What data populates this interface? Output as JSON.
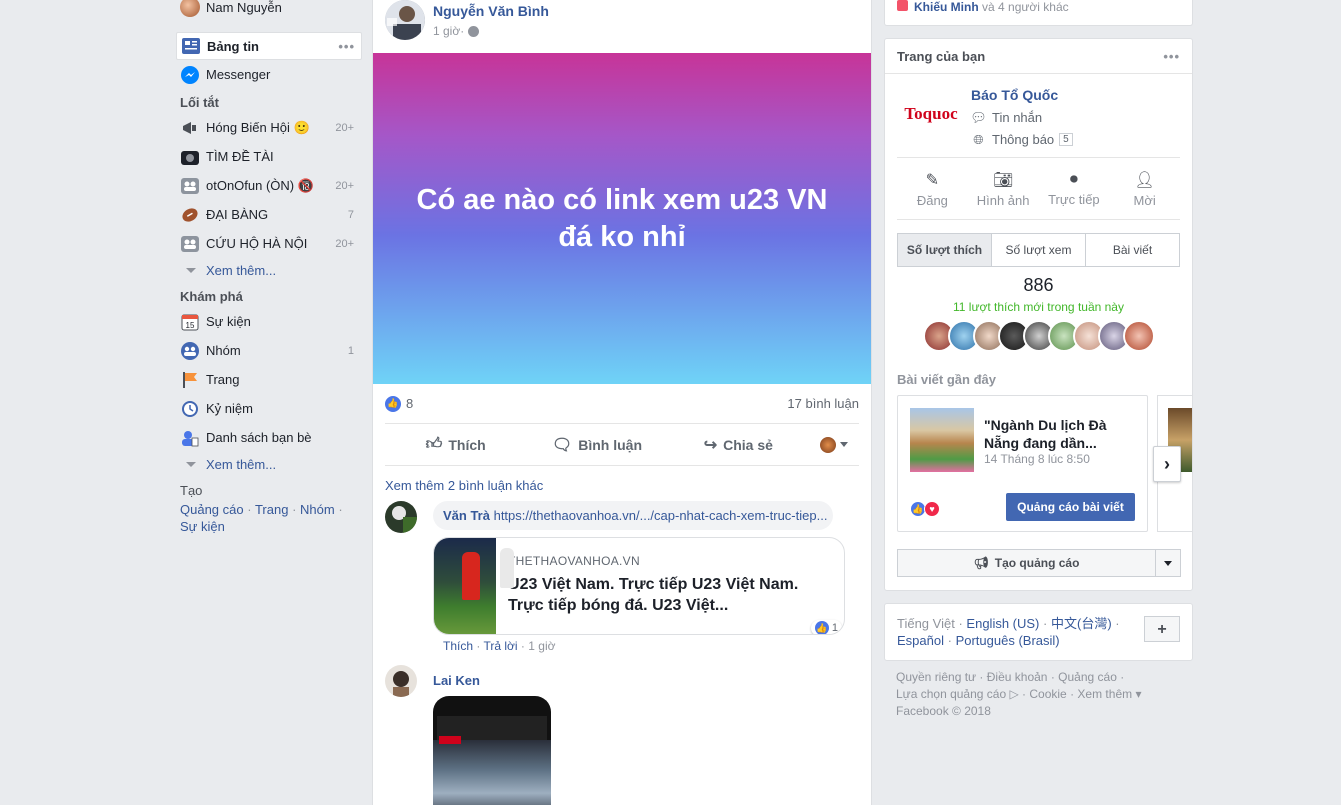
{
  "left": {
    "profile_name": "Nam Nguyễn",
    "news_feed": "Bảng tin",
    "messenger": "Messenger",
    "shortcuts_title": "Lối tắt",
    "shortcuts": [
      {
        "label": "Hóng Biến Hội 🙂",
        "count": "20+"
      },
      {
        "label": "TÌM ĐỀ TÀI",
        "count": ""
      },
      {
        "label": "otOnOfun (ÒN) 🔞",
        "count": "20+"
      },
      {
        "label": "ĐẠI BÀNG",
        "count": "7"
      },
      {
        "label": "CỨU HỘ HÀ NỘI",
        "count": "20+"
      }
    ],
    "see_more": "Xem thêm...",
    "explore_title": "Khám phá",
    "explore": [
      {
        "label": "Sự kiện",
        "count": ""
      },
      {
        "label": "Nhóm",
        "count": "1"
      },
      {
        "label": "Trang",
        "count": ""
      },
      {
        "label": "Kỷ niệm",
        "count": ""
      },
      {
        "label": "Danh sách bạn bè",
        "count": ""
      }
    ],
    "create_title": "Tạo",
    "create_links": [
      "Quảng cáo",
      "Trang",
      "Nhóm",
      "Sự kiện"
    ]
  },
  "post": {
    "author": "Nguyễn Văn Bình",
    "time": "1 giờ",
    "text": "Có ae nào có link xem u23 VN đá ko nhỉ",
    "likes": "8",
    "comments_count": "17 bình luận",
    "like_label": "Thích",
    "comment_label": "Bình luận",
    "share_label": "Chia sẻ",
    "more_comments": "Xem thêm 2 bình luận khác",
    "comment1": {
      "name": "Văn Trà",
      "link": "https://thethaovanhoa.vn/.../cap-nhat-cach-xem-truc-tiep...",
      "card_domain": "THETHAOVANHOA.VN",
      "card_title": "U23 Việt Nam. Trực tiếp U23 Việt Nam. Trực tiếp bóng đá. U23 Việt...",
      "reactions": "1",
      "like": "Thích",
      "reply": "Trả lời",
      "time": "1 giờ"
    },
    "comment2": {
      "name": "Lai Ken"
    }
  },
  "right": {
    "top_text_name": "Khiếu Minh",
    "top_text_rest": "và 4 người khác",
    "your_pages": "Trang của bạn",
    "page_name": "Báo Tổ Quốc",
    "logo_text": "Toquoc",
    "messages": "Tin nhắn",
    "notifications": "Thông báo",
    "notif_count": "5",
    "actions": [
      "Đăng",
      "Hình ảnh",
      "Trực tiếp",
      "Mời"
    ],
    "tabs": [
      "Số lượt thích",
      "Số lượt xem",
      "Bài viết"
    ],
    "likes_total": "886",
    "new_likes": "11 lượt thích mới trong tuần này",
    "recent_title": "Bài viết gần đây",
    "recent_post_title": "\"Ngành Du lịch Đà Nẵng đang dần...",
    "recent_post_date": "14 Tháng 8 lúc 8:50",
    "boost_button": "Quảng cáo bài viết",
    "create_ad": "Tạo quảng cáo",
    "languages_line1": [
      "Tiếng Việt",
      "English (US)",
      "中文(台灣)"
    ],
    "languages_line2": [
      "Español",
      "Português (Brasil)"
    ],
    "footer_line1": [
      "Quyền riêng tư",
      "Điều khoản",
      "Quảng cáo"
    ],
    "footer_line2": [
      "Lựa chọn quảng cáo ▷",
      "Cookie",
      "Xem thêm ▾"
    ],
    "copyright": "Facebook © 2018"
  },
  "colors": {
    "brand_blue": "#4267b2",
    "link": "#365899",
    "background": "#e9ebee",
    "new_likes_green": "#42b72a"
  }
}
